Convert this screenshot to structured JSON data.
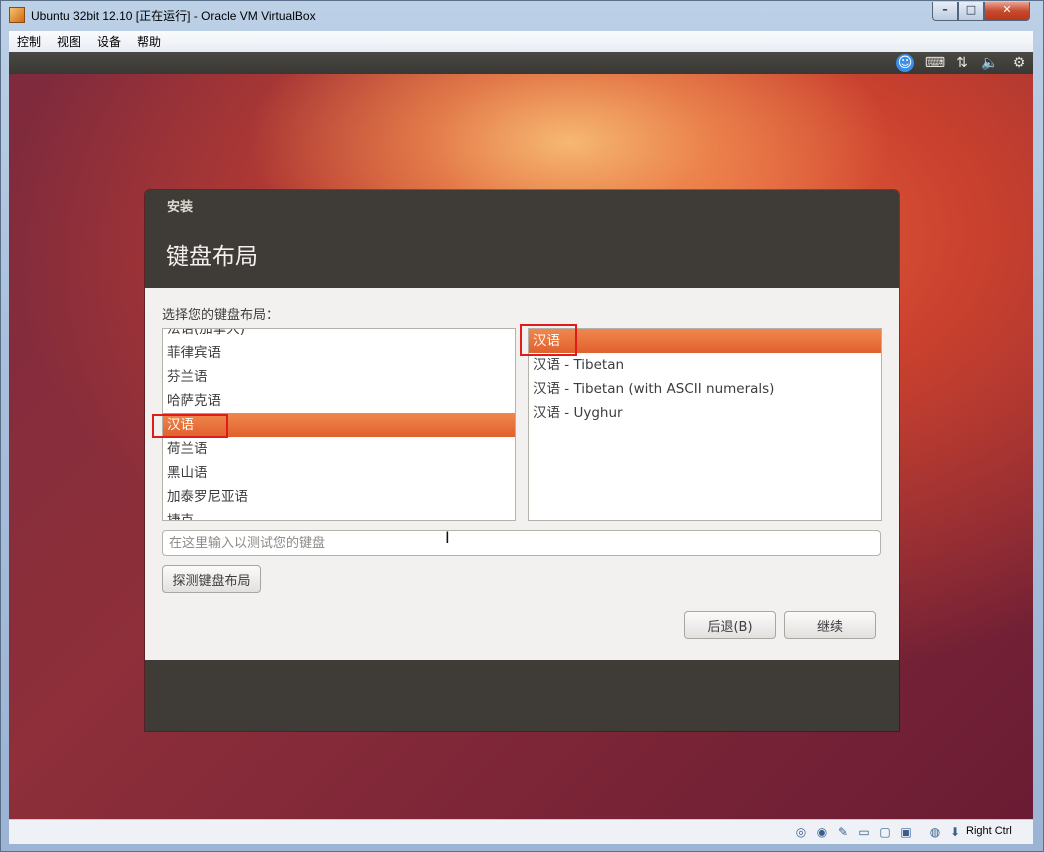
{
  "window": {
    "title": "Ubuntu 32bit 12.10 [正在运行] - Oracle VM VirtualBox",
    "minimize_icon": "minimize-icon",
    "maximize_icon": "maximize-icon",
    "close_icon": "close-icon"
  },
  "menubar": {
    "items": [
      "控制",
      "视图",
      "设备",
      "帮助"
    ]
  },
  "topbar": {
    "icons": [
      "accessibility-icon",
      "keyboard-icon",
      "network-icon",
      "volume-icon",
      "gear-icon"
    ]
  },
  "installer": {
    "app_name": "安装",
    "page_title": "键盘布局",
    "prompt": "选择您的键盘布局：",
    "layouts": [
      "法语(加拿大)",
      "菲律宾语",
      "芬兰语",
      "哈萨克语",
      "汉语",
      "荷兰语",
      "黑山语",
      "加泰罗尼亚语",
      "捷克"
    ],
    "selected_layout": "汉语",
    "variants": [
      "汉语",
      "汉语 - Tibetan",
      "汉语 - Tibetan (with ASCII numerals)",
      "汉语 - Uyghur"
    ],
    "selected_variant": "汉语",
    "test_placeholder": "在这里输入以测试您的键盘",
    "detect_button": "探测键盘布局",
    "back_button": "后退(B)",
    "continue_button": "继续"
  },
  "statusbar": {
    "host_key": "Right Ctrl",
    "icons": [
      "hard-disk-icon",
      "cd-icon",
      "usb-icon",
      "network-icon",
      "shared-folder-icon",
      "display-icon",
      "capture-icon",
      "keyboard-capture-icon"
    ]
  },
  "colors": {
    "selection": "#e0612d",
    "highlight_box": "#e01b1b",
    "dialog_dark": "#3f3c37"
  }
}
